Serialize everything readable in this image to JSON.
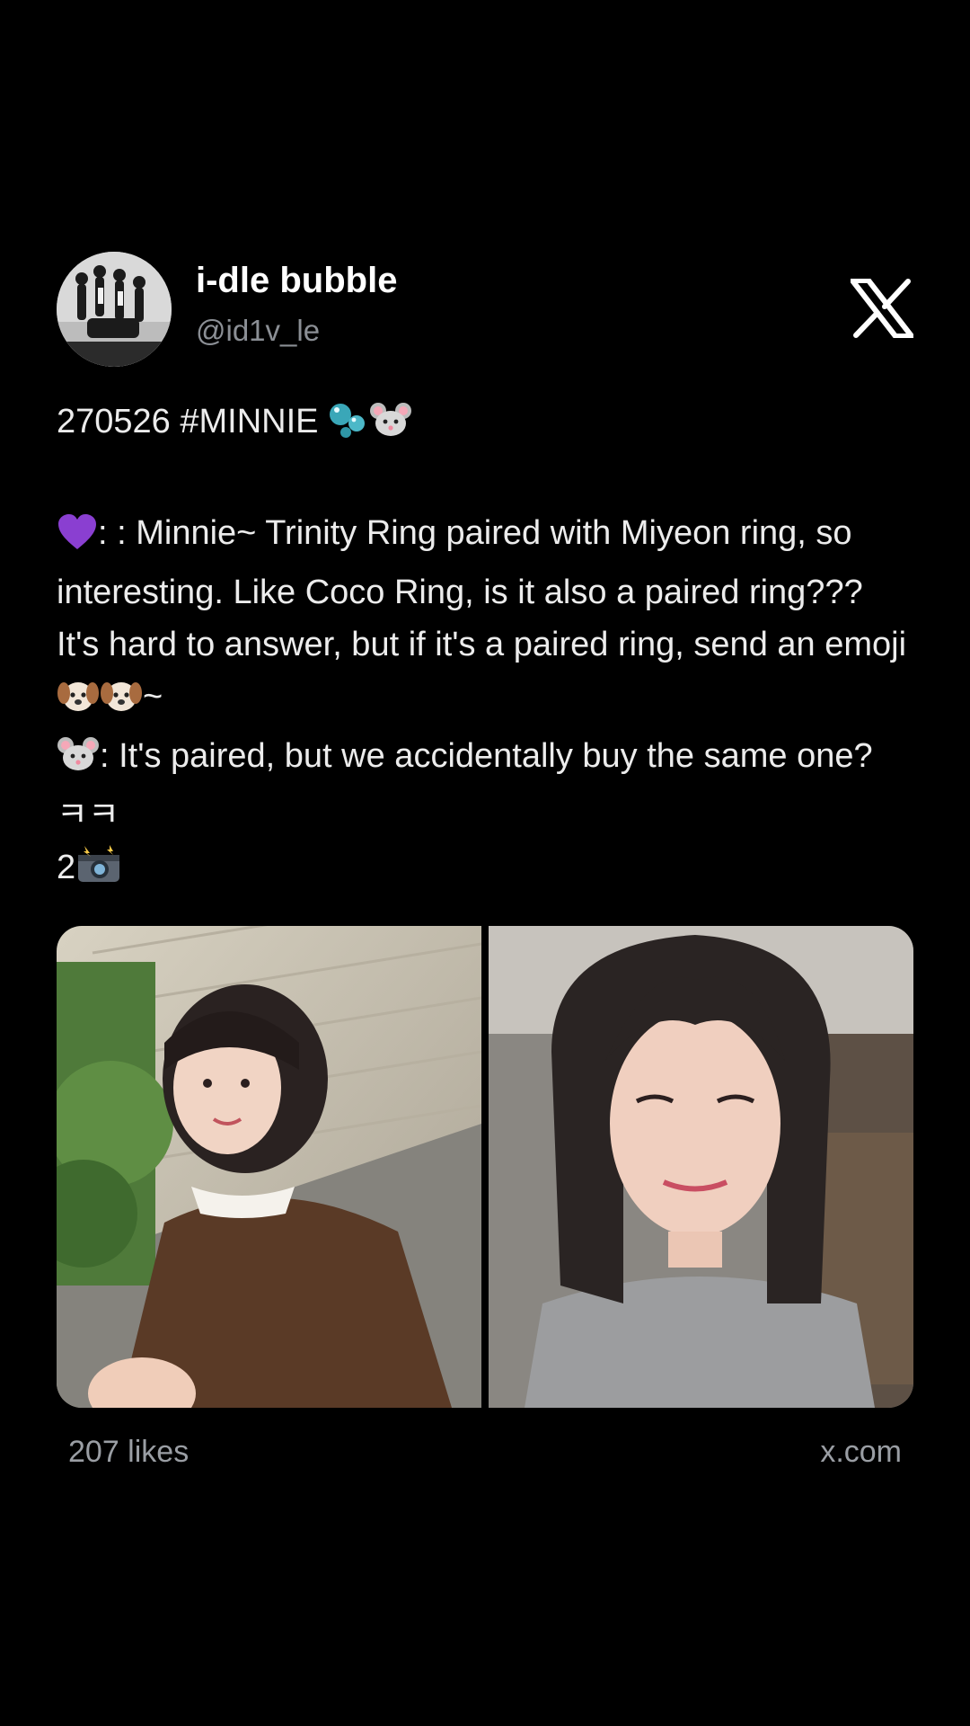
{
  "account": {
    "display_name": "i-dle bubble",
    "handle": "@id1v_le"
  },
  "tweet": {
    "line1": "270526 #MINNIE ",
    "line2": ": : Minnie~ Trinity Ring paired with Miyeon ring, so interesting. Like Coco Ring, is it also a paired ring??? It's hard to answer, but if it's a paired ring, send an emoji ",
    "line2_end": "~",
    "line3": ": It's paired, but we accidentally buy the same one? ㅋㅋ",
    "line4": "2"
  },
  "icons": {
    "logo": "x-logo-icon",
    "bubbles": "bubbles-emoji",
    "mouse": "mouse-face-emoji",
    "heart": "purple-heart-emoji",
    "dog": "dog-face-emoji",
    "camera": "camera-flash-emoji"
  },
  "footer": {
    "likes": "207 likes",
    "site": "x.com"
  },
  "colors": {
    "background": "#000000",
    "text": "#e7e9ea",
    "muted": "#8b8f95",
    "purple_heart": "#8a3fd1"
  }
}
